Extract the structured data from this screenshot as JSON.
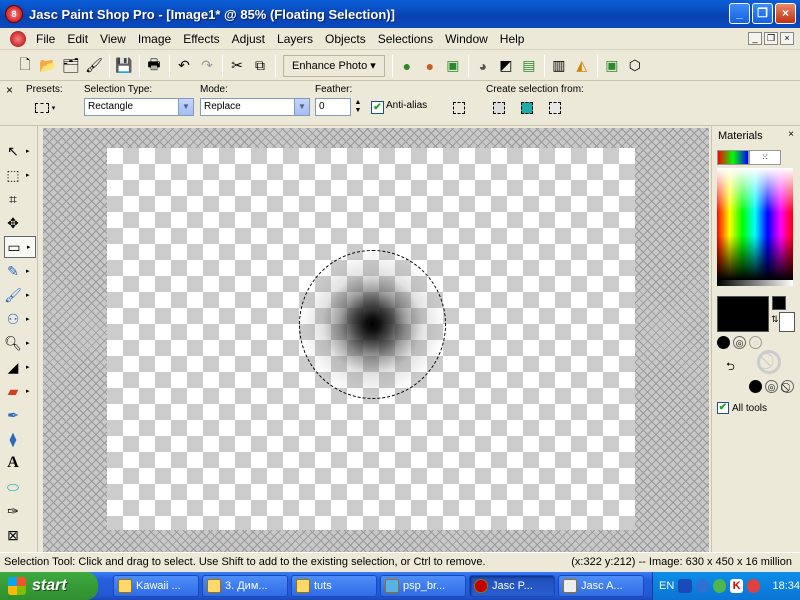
{
  "window": {
    "title": "Jasc Paint Shop Pro - [Image1* @  85% (Floating Selection)]",
    "app_icon": "psp-logo-icon",
    "buttons": [
      "_",
      "❐",
      "×"
    ]
  },
  "menu": {
    "items": [
      "File",
      "Edit",
      "View",
      "Image",
      "Effects",
      "Adjust",
      "Layers",
      "Objects",
      "Selections",
      "Window",
      "Help"
    ],
    "mdi_buttons": [
      "_",
      "❐",
      "×"
    ]
  },
  "toolbar": {
    "enhance_label": "Enhance Photo ▾",
    "icons": [
      "new-icon",
      "open-icon",
      "browse-icon",
      "scan-icon",
      "save-icon",
      "print-icon",
      "undo-icon",
      "redo-icon",
      "cut-icon",
      "copy-icon",
      "paste-icon"
    ]
  },
  "options": {
    "presets_label": "Presets:",
    "selection_type_label": "Selection Type:",
    "selection_type_value": "Rectangle",
    "mode_label": "Mode:",
    "mode_value": "Replace",
    "feather_label": "Feather:",
    "feather_value": "0",
    "antialias_label": "Anti-alias",
    "antialias_checked": true,
    "create_from_label": "Create selection from:"
  },
  "tools": [
    "pointer",
    "selection",
    "crop",
    "move",
    "freehand-selection",
    "dropper",
    "paint-brush",
    "clone",
    "zoom",
    "fill",
    "eraser",
    "picture-tube",
    "airbrush",
    "text",
    "preset-shape",
    "pen",
    "deformation"
  ],
  "materials": {
    "title": "Materials",
    "close": "×",
    "all_tools_label": "All tools",
    "all_tools_checked": true,
    "foreground_color": "#000000",
    "background_color": "#ffffff"
  },
  "status": {
    "left": "Selection Tool: Click and drag to select. Use Shift to add to the existing selection, or Ctrl to remove.",
    "right": "(x:322 y:212) -- Image:  630 x 450 x 16 million"
  },
  "taskbar": {
    "start_label": "start",
    "tasks": [
      {
        "label": "Kawaii ...",
        "active": false
      },
      {
        "label": "3. Дим...",
        "active": false
      },
      {
        "label": "tuts",
        "active": false
      },
      {
        "label": "psp_br...",
        "active": false
      },
      {
        "label": "Jasc P...",
        "active": true
      },
      {
        "label": "Jasc A...",
        "active": false
      }
    ],
    "lang": "EN",
    "time": "18:34"
  }
}
